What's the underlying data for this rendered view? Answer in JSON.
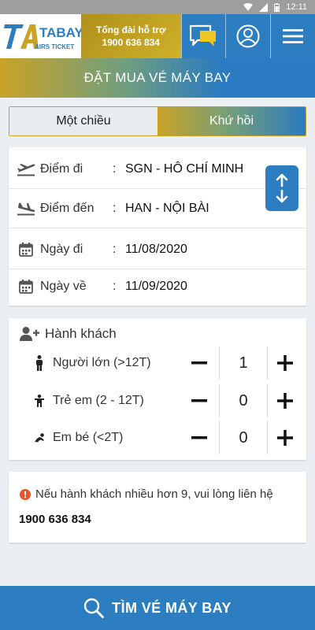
{
  "status_bar": {
    "time": "12:11"
  },
  "header": {
    "logo_main": "TABAY",
    "logo_sub": "AIRS TICKET",
    "hotline_label": "Tổng đài hỗ trợ",
    "hotline_number": "1900 636 834"
  },
  "title": "ĐẶT MUA VÉ MÁY BAY",
  "trip_type": {
    "one_way": "Một chiều",
    "round_trip": "Khứ hồi",
    "selected": "round_trip"
  },
  "route": {
    "from": {
      "label": "Điểm đi",
      "value": "SGN - HÔ CHÍ MINH"
    },
    "to": {
      "label": "Điểm đến",
      "value": "HAN - NỘI BÀI"
    },
    "depart": {
      "label": "Ngày đi",
      "value": "11/08/2020"
    },
    "return": {
      "label": "Ngày về",
      "value": "11/09/2020"
    },
    "separator": ":"
  },
  "passengers": {
    "title": "Hành khách",
    "rows": [
      {
        "label": "Người lớn (>12T)",
        "count": "1"
      },
      {
        "label": "Trẻ em (2 - 12T)",
        "count": "0"
      },
      {
        "label": "Em bé (<2T)",
        "count": "0"
      }
    ]
  },
  "note": {
    "text": "Nếu hành khách nhiều hơn 9, vui lòng liên hệ",
    "phone": "1900 636 834"
  },
  "search_button": "TÌM VÉ MÁY BAY",
  "colors": {
    "primary": "#2d7ec0",
    "gold": "#c9a227",
    "background": "#eceff1"
  }
}
